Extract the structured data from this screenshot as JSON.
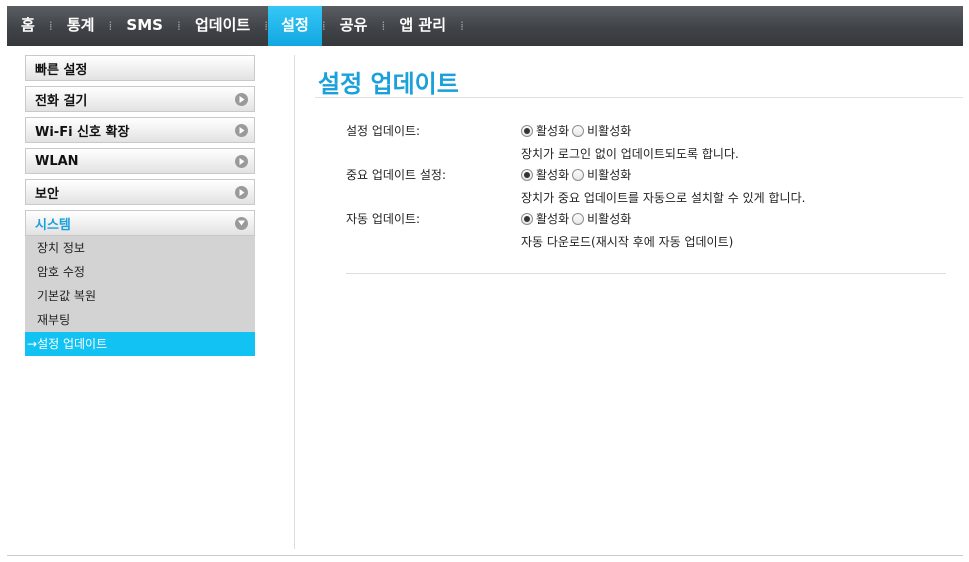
{
  "nav": {
    "items": [
      "홈",
      "통계",
      "SMS",
      "업데이트",
      "설정",
      "공유",
      "앱 관리"
    ],
    "active_index": 4,
    "separator": "⁞"
  },
  "sidebar": {
    "items": [
      {
        "label": "빠른 설정"
      },
      {
        "label": "전화 걸기"
      },
      {
        "label": "Wi-Fi 신호 확장"
      },
      {
        "label": "WLAN"
      },
      {
        "label": "보안"
      },
      {
        "label": "시스템"
      }
    ],
    "submenu": [
      "장치 정보",
      "암호 수정",
      "기본값 복원",
      "재부팅",
      "설정 업데이트"
    ],
    "active_sub_arrow": "→"
  },
  "page": {
    "title": "설정 업데이트",
    "rows": [
      {
        "label": "설정 업데이트:",
        "option_on": "활성화",
        "option_off": "비활성화",
        "selected": "on",
        "description": "장치가 로그인 없이 업데이트되도록 합니다."
      },
      {
        "label": "중요 업데이트 설정:",
        "option_on": "활성화",
        "option_off": "비활성화",
        "selected": "on",
        "description": "장치가 중요 업데이트를 자동으로 설치할 수 있게 합니다."
      },
      {
        "label": "자동 업데이트:",
        "option_on": "활성화",
        "option_off": "비활성화",
        "selected": "on",
        "description": "자동 다운로드(재시작 후에 자동 업데이트)"
      }
    ]
  },
  "colors": {
    "accent": "#1aa0db",
    "nav_bg": "#404448",
    "active_sub_bg": "#11c2f2"
  }
}
